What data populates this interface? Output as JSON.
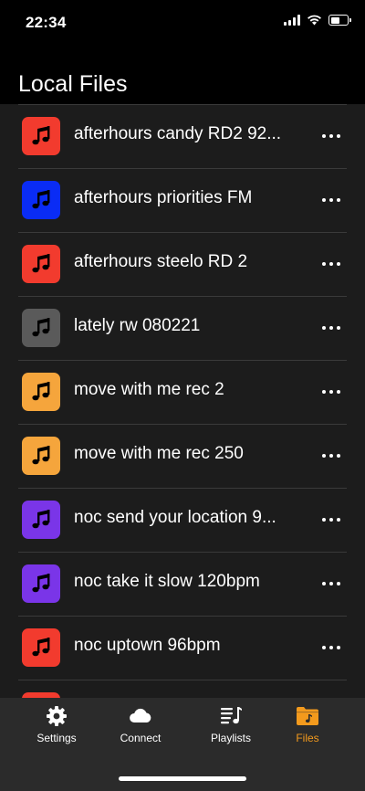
{
  "status": {
    "time": "22:34"
  },
  "header": {
    "title": "Local Files"
  },
  "files": [
    {
      "label": "afterhours candy RD2 92...",
      "color": "#f23b2e"
    },
    {
      "label": "afterhours priorities FM",
      "color": "#0a2cf5"
    },
    {
      "label": "afterhours steelo RD 2",
      "color": "#f23b2e"
    },
    {
      "label": "lately rw 080221",
      "color": "#5a5a5a"
    },
    {
      "label": "move with me rec 2",
      "color": "#f5a53c"
    },
    {
      "label": "move with me rec 250",
      "color": "#f5a53c"
    },
    {
      "label": "noc send your location 9...",
      "color": "#7a35e8"
    },
    {
      "label": "noc take it slow 120bpm",
      "color": "#7a35e8"
    },
    {
      "label": "noc uptown 96bpm",
      "color": "#f23b2e"
    },
    {
      "label": "",
      "color": "#f23b2e"
    }
  ],
  "tabs": [
    {
      "label": "Settings",
      "icon": "gear-icon"
    },
    {
      "label": "Connect",
      "icon": "cloud-icon"
    },
    {
      "label": "Playlists",
      "icon": "playlist-icon"
    },
    {
      "label": "Files",
      "icon": "folder-music-icon",
      "active": true
    }
  ],
  "colors": {
    "accent": "#f39a1d",
    "tab_bar": "#2b2b2b",
    "list_bg": "#1c1c1c"
  }
}
